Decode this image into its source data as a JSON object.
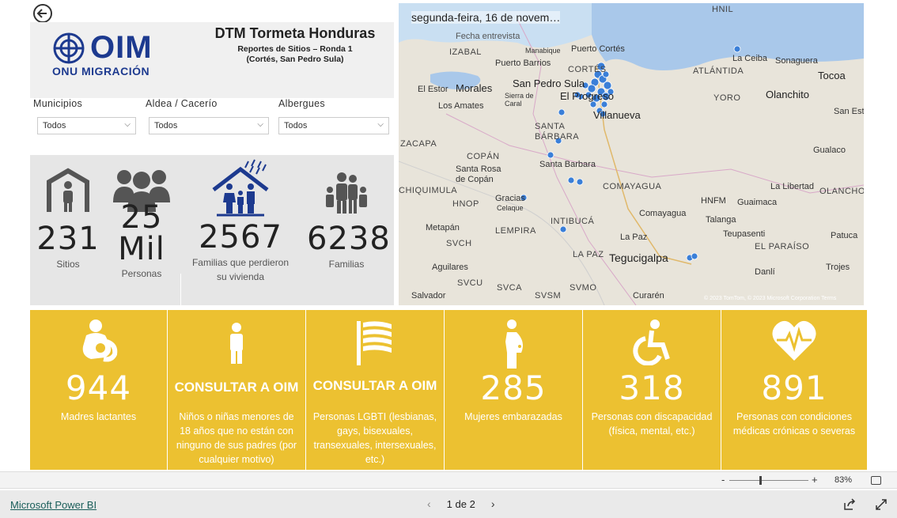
{
  "header": {
    "logo_main": "OIM",
    "logo_sub": "ONU MIGRACIÓN",
    "title": "DTM Tormeta Honduras",
    "subtitle_line1": "Reportes de Sitios – Ronda 1",
    "subtitle_line2": "(Cortés, San Pedro Sula)"
  },
  "filters": [
    {
      "label": "Municipios",
      "value": "Todos"
    },
    {
      "label": "Aldea / Cacerío",
      "value": "Todos"
    },
    {
      "label": "Albergues",
      "value": "Todos"
    }
  ],
  "stats": [
    {
      "value": "231",
      "label": "Sitios",
      "icon": "shelter-person-icon"
    },
    {
      "value": "25",
      "value2": "Mil",
      "label": "Personas",
      "icon": "group-people-icon"
    },
    {
      "value": "2567",
      "label": "Familias que perdieron",
      "label2": "su vivienda",
      "icon": "family-rain-house-icon"
    },
    {
      "value": "6238",
      "label": "Familias",
      "icon": "family-icon"
    }
  ],
  "map": {
    "date_label": "segunda-feira, 16 de novem…",
    "sub_label": "Fecha entrevista",
    "attribution": "© 2023 TomTom, © 2023 Microsoft Corporation  Terms",
    "places": [
      "HNIL",
      "La Ceiba",
      "Sonaguera",
      "Tocoa",
      "ATLÁNTIDA",
      "IZABAL",
      "Puerto Barrios",
      "Puerto Cortés",
      "Manabique",
      "El Estor",
      "Morales",
      "San Pedro Sula",
      "CORTÉS",
      "YORO",
      "Olanchito",
      "Los Amates",
      "Sierra de Caral",
      "El Progreso",
      "Villanueva",
      "San Este",
      "ZACAPA",
      "SANTA BÁRBARA",
      "COPÁN",
      "Santa Rosa de Copán",
      "Santa Barbara",
      "Gualaco",
      "CHIQUIMULA",
      "COMAYAGUA",
      "HNOP",
      "Gracias",
      "Celaque",
      "La Libertad",
      "Guaimaca",
      "HNFM",
      "Comayagua",
      "OLANCHO",
      "Metapán",
      "INTIBUCÁ",
      "Talanga",
      "Teupasenti",
      "LEMPIRA",
      "La Paz",
      "SVCH",
      "Patuca",
      "Aguilares",
      "LA PAZ",
      "Tegucigalpa",
      "EL PARAÍSO",
      "SVCU",
      "Danlí",
      "SVCA",
      "SVMO",
      "Salvador",
      "SVSM",
      "Curarén",
      "Trojes"
    ]
  },
  "indicators": [
    {
      "value": "944",
      "label": "Madres lactantes",
      "icon": "breastfeeding-mother-icon"
    },
    {
      "consult": "CONSULTAR A OIM",
      "label": "Niños o niñas menores de 18 años que no están con ninguno de sus padres (por cualquier motivo)",
      "icon": "child-icon"
    },
    {
      "consult": "CONSULTAR A OIM",
      "label": "Personas LGBTI (lesbianas, gays, bisexuales, transexuales, intersexuales, etc.)",
      "icon": "pride-flag-icon"
    },
    {
      "value": "285",
      "label": "Mujeres embarazadas",
      "icon": "pregnant-woman-icon"
    },
    {
      "value": "318",
      "label": "Personas con discapacidad (física, mental, etc.)",
      "icon": "wheelchair-icon"
    },
    {
      "value": "891",
      "label": "Personas con condiciones médicas crónicas o severas",
      "icon": "heart-pulse-icon"
    }
  ],
  "zoom": {
    "minus": "-",
    "plus": "+",
    "level": "83%"
  },
  "footer": {
    "brand": "Microsoft Power BI",
    "page": "1 de 2",
    "prev": "‹",
    "next": "›"
  },
  "colors": {
    "yellow": "#ecc131",
    "oim_blue": "#1d3a8f",
    "map_point": "#3a7fd8"
  }
}
